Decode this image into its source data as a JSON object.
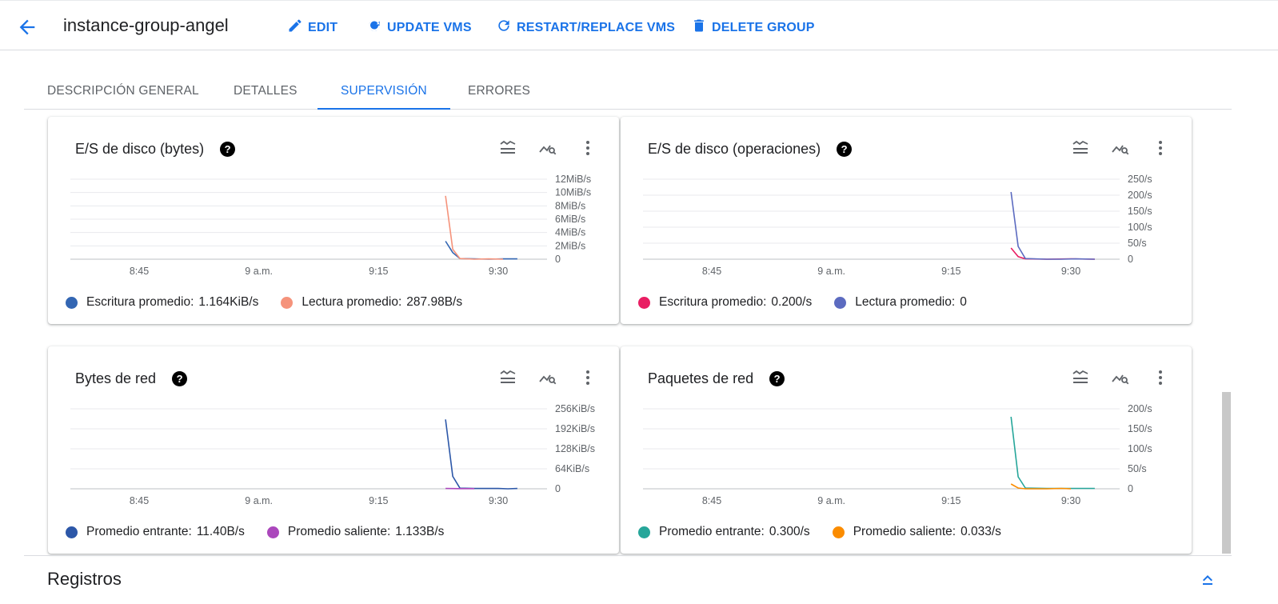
{
  "header": {
    "title": "instance-group-angel",
    "actions": [
      {
        "label": "EDIT",
        "icon": "pencil-icon"
      },
      {
        "label": "UPDATE VMS",
        "icon": "update-icon"
      },
      {
        "label": "RESTART/REPLACE VMS",
        "icon": "restart-icon"
      },
      {
        "label": "DELETE GROUP",
        "icon": "trash-icon"
      }
    ]
  },
  "tabs": [
    {
      "label": "DESCRIPCIÓN GENERAL",
      "active": false
    },
    {
      "label": "DETALLES",
      "active": false
    },
    {
      "label": "SUPERVISIÓN",
      "active": true
    },
    {
      "label": "ERRORES",
      "active": false
    }
  ],
  "cards": [
    {
      "title": "E/S de disco (bytes)",
      "legend": [
        {
          "label": "Escritura promedio:",
          "value": "1.164KiB/s",
          "color": "#3366b3"
        },
        {
          "label": "Lectura promedio:",
          "value": "287.98B/s",
          "color": "#f5937b"
        }
      ]
    },
    {
      "title": "E/S de disco (operaciones)",
      "legend": [
        {
          "label": "Escritura promedio:",
          "value": "0.200/s",
          "color": "#e91e63"
        },
        {
          "label": "Lectura promedio:",
          "value": "0",
          "color": "#5c6bc0"
        }
      ]
    },
    {
      "title": "Bytes de red",
      "legend": [
        {
          "label": "Promedio entrante:",
          "value": "11.40B/s",
          "color": "#2c57a8"
        },
        {
          "label": "Promedio saliente:",
          "value": "1.133B/s",
          "color": "#ab47bc"
        }
      ]
    },
    {
      "title": "Paquetes de red",
      "legend": [
        {
          "label": "Promedio entrante:",
          "value": "0.300/s",
          "color": "#26a69a"
        },
        {
          "label": "Promedio saliente:",
          "value": "0.033/s",
          "color": "#fb8c00"
        }
      ]
    }
  ],
  "card_icon_names": [
    "legend-toggle-icon",
    "explore-icon",
    "more-vert-icon"
  ],
  "footer": {
    "section_title": "Registros"
  },
  "chart_data": [
    {
      "type": "line",
      "title": "E/S de disco (bytes)",
      "x_ticks": [
        "8:45",
        "9 a.m.",
        "9:15",
        "9:30"
      ],
      "y_ticks": [
        "0",
        "2MiB/s",
        "4MiB/s",
        "6MiB/s",
        "8MiB/s",
        "10MiB/s",
        "12MiB/s"
      ],
      "ylim": [
        0,
        12
      ],
      "x_minutes_ticks": [
        8.75,
        9.0,
        9.25,
        9.5
      ],
      "series": [
        {
          "name": "Escritura promedio",
          "color": "#3366b3",
          "points": [
            [
              9.39,
              2.7
            ],
            [
              9.405,
              1.0
            ],
            [
              9.42,
              0.1
            ],
            [
              9.45,
              0.05
            ],
            [
              9.48,
              0.0
            ],
            [
              9.51,
              0.05
            ],
            [
              9.54,
              0.05
            ]
          ]
        },
        {
          "name": "Lectura promedio",
          "color": "#f5937b",
          "points": [
            [
              9.39,
              9.5
            ],
            [
              9.405,
              1.5
            ],
            [
              9.42,
              0.1
            ],
            [
              9.45,
              0.0
            ],
            [
              9.48,
              0.05
            ],
            [
              9.51,
              0.0
            ]
          ]
        }
      ]
    },
    {
      "type": "line",
      "title": "E/S de disco (operaciones)",
      "x_ticks": [
        "8:45",
        "9 a.m.",
        "9:15",
        "9:30"
      ],
      "y_ticks": [
        "0",
        "50/s",
        "100/s",
        "150/s",
        "200/s",
        "250/s"
      ],
      "ylim": [
        0,
        250
      ],
      "x_minutes_ticks": [
        8.75,
        9.0,
        9.25,
        9.5
      ],
      "series": [
        {
          "name": "Escritura promedio",
          "color": "#e91e63",
          "points": [
            [
              9.375,
              35
            ],
            [
              9.39,
              8
            ],
            [
              9.405,
              1
            ],
            [
              9.45,
              0
            ],
            [
              9.5,
              1
            ],
            [
              9.55,
              0
            ]
          ]
        },
        {
          "name": "Lectura promedio",
          "color": "#5c6bc0",
          "points": [
            [
              9.375,
              210
            ],
            [
              9.39,
              40
            ],
            [
              9.405,
              2
            ],
            [
              9.45,
              0
            ],
            [
              9.48,
              0
            ],
            [
              9.51,
              1
            ],
            [
              9.55,
              0
            ]
          ]
        }
      ]
    },
    {
      "type": "line",
      "title": "Bytes de red",
      "x_ticks": [
        "8:45",
        "9 a.m.",
        "9:15",
        "9:30"
      ],
      "y_ticks": [
        "0",
        "64KiB/s",
        "128KiB/s",
        "192KiB/s",
        "256KiB/s"
      ],
      "ylim": [
        0,
        256
      ],
      "x_minutes_ticks": [
        8.75,
        9.0,
        9.25,
        9.5
      ],
      "series": [
        {
          "name": "Promedio entrante",
          "color": "#2c57a8",
          "points": [
            [
              9.39,
              222
            ],
            [
              9.405,
              40
            ],
            [
              9.42,
              2
            ],
            [
              9.45,
              1
            ],
            [
              9.5,
              1
            ],
            [
              9.52,
              0
            ],
            [
              9.54,
              1
            ]
          ]
        },
        {
          "name": "Promedio saliente",
          "color": "#ab47bc",
          "points": [
            [
              9.39,
              1
            ],
            [
              9.42,
              0.5
            ],
            [
              9.45,
              0.5
            ]
          ]
        }
      ]
    },
    {
      "type": "line",
      "title": "Paquetes de red",
      "x_ticks": [
        "8:45",
        "9 a.m.",
        "9:15",
        "9:30"
      ],
      "y_ticks": [
        "0",
        "50/s",
        "100/s",
        "150/s",
        "200/s"
      ],
      "ylim": [
        0,
        200
      ],
      "x_minutes_ticks": [
        8.75,
        9.0,
        9.25,
        9.5
      ],
      "series": [
        {
          "name": "Promedio entrante",
          "color": "#26a69a",
          "points": [
            [
              9.375,
              180
            ],
            [
              9.39,
              30
            ],
            [
              9.405,
              2
            ],
            [
              9.45,
              1
            ],
            [
              9.5,
              1
            ],
            [
              9.55,
              1
            ]
          ]
        },
        {
          "name": "Promedio saliente",
          "color": "#fb8c00",
          "points": [
            [
              9.375,
              12
            ],
            [
              9.39,
              2
            ],
            [
              9.405,
              0
            ],
            [
              9.45,
              0
            ],
            [
              9.48,
              1
            ],
            [
              9.5,
              0
            ]
          ]
        }
      ]
    }
  ]
}
